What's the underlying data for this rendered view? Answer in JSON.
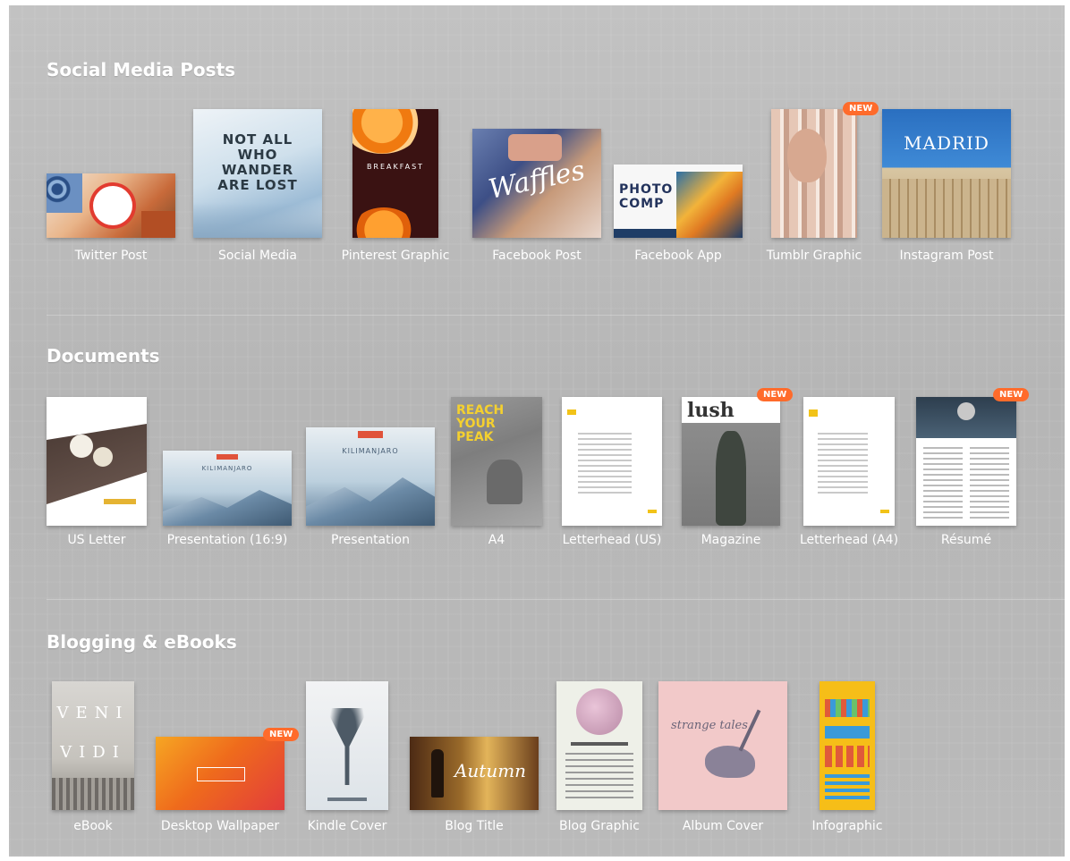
{
  "sections": [
    {
      "title": "Social Media Posts",
      "items": [
        {
          "label": "Twitter Post"
        },
        {
          "label": "Social Media",
          "thumb_text": "NOT ALL WHO WANDER ARE LOST"
        },
        {
          "label": "Pinterest Graphic",
          "thumb_text": "BREAKFAST"
        },
        {
          "label": "Facebook Post",
          "thumb_text": "Waffles"
        },
        {
          "label": "Facebook App",
          "thumb_text": "PHOTO COMP"
        },
        {
          "label": "Tumblr Graphic",
          "badge": "NEW"
        },
        {
          "label": "Instagram Post",
          "thumb_text": "MADRID"
        }
      ]
    },
    {
      "title": "Documents",
      "items": [
        {
          "label": "US Letter"
        },
        {
          "label": "Presentation (16:9)",
          "thumb_text": "KILIMANJARO"
        },
        {
          "label": "Presentation",
          "thumb_text": "KILIMANJARO"
        },
        {
          "label": "A4",
          "thumb_text": "REACH YOUR PEAK"
        },
        {
          "label": "Letterhead (US)"
        },
        {
          "label": "Magazine",
          "badge": "NEW",
          "thumb_text": "lush"
        },
        {
          "label": "Letterhead (A4)"
        },
        {
          "label": "Résumé",
          "badge": "NEW"
        }
      ]
    },
    {
      "title": "Blogging & eBooks",
      "items": [
        {
          "label": "eBook",
          "thumb_text": "VENI VIDI"
        },
        {
          "label": "Desktop Wallpaper",
          "badge": "NEW"
        },
        {
          "label": "Kindle Cover"
        },
        {
          "label": "Blog Title",
          "thumb_text": "Autumn"
        },
        {
          "label": "Blog Graphic"
        },
        {
          "label": "Album Cover",
          "thumb_text": "strange tales"
        },
        {
          "label": "Infographic"
        }
      ]
    }
  ]
}
